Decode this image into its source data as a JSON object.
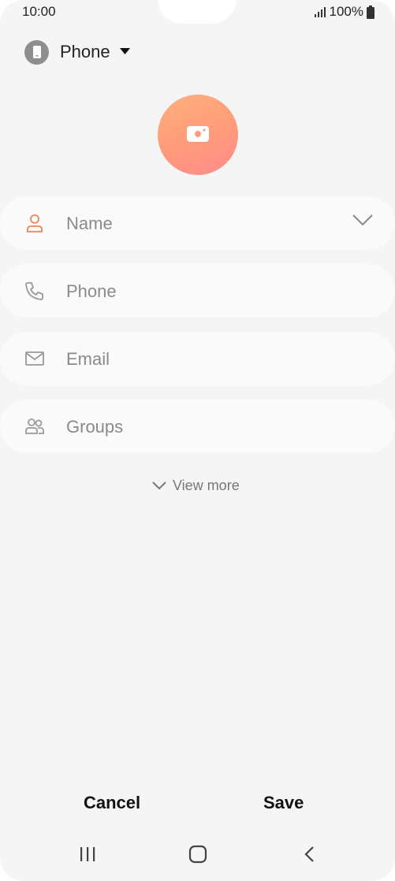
{
  "status_bar": {
    "time": "10:00",
    "battery": "100%"
  },
  "storage": {
    "label": "Phone"
  },
  "fields": {
    "name": {
      "placeholder": "Name"
    },
    "phone": {
      "placeholder": "Phone"
    },
    "email": {
      "placeholder": "Email"
    },
    "groups": {
      "placeholder": "Groups"
    }
  },
  "view_more": {
    "label": "View more"
  },
  "actions": {
    "cancel_label": "Cancel",
    "save_label": "Save"
  },
  "colors": {
    "background": "#f5f5f5",
    "field": "#fafafa",
    "accent": "#ff9a7a",
    "name_icon": "#e8875a"
  },
  "icons": {
    "storage": "phone-device-icon",
    "photo": "camera-icon",
    "name": "person-icon",
    "phone": "phone-icon",
    "email": "envelope-icon",
    "groups": "people-icon"
  }
}
